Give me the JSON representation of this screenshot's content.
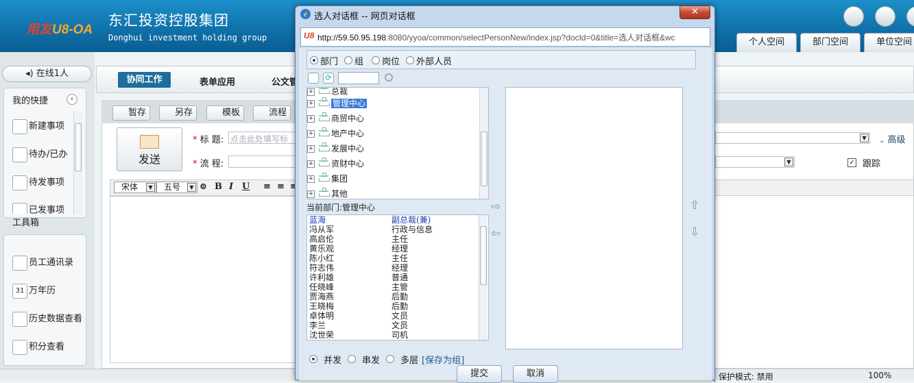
{
  "header": {
    "logo_brand": "用友",
    "logo_suffix": "U8-OA",
    "company_cn": "东汇投资控股集团",
    "company_en": "Donghui investment holding group",
    "tabs": [
      "个人空间",
      "部门空间",
      "单位空间"
    ]
  },
  "sidebar": {
    "online": "在线1人",
    "shortcut_title": "我的快捷",
    "shortcut_collapse": "‹",
    "shortcuts": [
      "新建事项",
      "待办/已办",
      "待发事项",
      "已发事项"
    ],
    "toolbox_title": "工具箱",
    "tools": [
      "员工通讯录",
      "万年历",
      "历史数据查看",
      "积分查看"
    ],
    "calendar_num": "31"
  },
  "nav": {
    "items": [
      "协同工作",
      "表单应用",
      "公文管"
    ]
  },
  "form": {
    "toolbar": [
      "暂存",
      "另存",
      "模板",
      "流程"
    ],
    "send_label": "发送",
    "req_mark": "*",
    "title_label": "标  题:",
    "title_placeholder": "点击此处填写标",
    "process_label": "流  程:",
    "advanced": "高级",
    "track_label": "跟踪",
    "track_check": "✓",
    "font_name": "宋体",
    "font_size": "五号",
    "bold": "B",
    "italic": "I",
    "underline": "U",
    "align_left": "≡",
    "align_center": "≡",
    "align_right": "≡"
  },
  "statusbar": {
    "protected_mode": "| 保护模式: 禁用",
    "zoom": "100%"
  },
  "dialog": {
    "title": "选人对话框 -- 网页对话框",
    "close": "✕",
    "url_host": "http://59.50.95.198",
    "url_rest": ":8080/yyoa/common/selectPersonNew/index.jsp?docId=0&title=选人对话框&wc",
    "types": [
      {
        "label": "部门",
        "checked": true
      },
      {
        "label": "组",
        "checked": false
      },
      {
        "label": "岗位",
        "checked": false
      },
      {
        "label": "外部人员",
        "checked": false
      }
    ],
    "tree": [
      {
        "label": "总裁",
        "selected": false
      },
      {
        "label": "管理中心",
        "selected": true
      },
      {
        "label": "商贸中心",
        "selected": false
      },
      {
        "label": "地产中心",
        "selected": false
      },
      {
        "label": "发展中心",
        "selected": false
      },
      {
        "label": "资财中心",
        "selected": false
      },
      {
        "label": "集团",
        "selected": false
      },
      {
        "label": "其他",
        "selected": false
      }
    ],
    "current_dept": "当前部门:管理中心",
    "people": [
      {
        "name": "蓝海",
        "role": "副总裁(兼)",
        "highlight": true
      },
      {
        "name": "冯从军",
        "role": "行政与信息",
        "highlight": false
      },
      {
        "name": "高启伦",
        "role": "主任",
        "highlight": false
      },
      {
        "name": "黄乐观",
        "role": "经理",
        "highlight": false
      },
      {
        "name": "陈小红",
        "role": "主任",
        "highlight": false
      },
      {
        "name": "符志伟",
        "role": "经理",
        "highlight": false
      },
      {
        "name": "许利雄",
        "role": "普通",
        "highlight": false
      },
      {
        "name": "任晓峰",
        "role": "主管",
        "highlight": false
      },
      {
        "name": "贾海燕",
        "role": "后勤",
        "highlight": false
      },
      {
        "name": "王晓梅",
        "role": "后勤",
        "highlight": false
      },
      {
        "name": "卓体明",
        "role": "文员",
        "highlight": false
      },
      {
        "name": "李兰",
        "role": "文员",
        "highlight": false
      },
      {
        "name": "沈世荣",
        "role": "司机",
        "highlight": false
      }
    ],
    "arrows": {
      "right": "⇨",
      "left": "⇦",
      "up": "⇧",
      "down": "⇩"
    },
    "modes": [
      {
        "label": "并发",
        "checked": true
      },
      {
        "label": "串发",
        "checked": false
      },
      {
        "label": "多层",
        "checked": false
      }
    ],
    "save_group": "[保存为组]",
    "submit": "提交",
    "cancel": "取消"
  }
}
